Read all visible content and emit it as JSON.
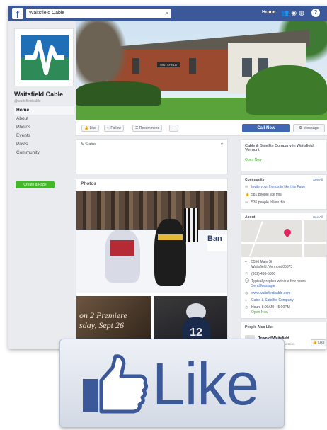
{
  "topbar": {
    "search_value": "Waitsfield Cable",
    "home_label": "Home"
  },
  "page": {
    "name": "Waitsfield Cable",
    "handle": "@waitsfieldcable"
  },
  "nav": {
    "items": [
      "Home",
      "About",
      "Photos",
      "Events",
      "Posts",
      "Community"
    ],
    "create_page": "Create a Page"
  },
  "cover": {
    "sign_text": "WAITSFIELD"
  },
  "actions": {
    "like": "Like",
    "follow": "Follow",
    "recommend": "Recommend",
    "more": "···",
    "call_now": "Call Now",
    "message": "Message"
  },
  "status": {
    "label": "Status"
  },
  "photos": {
    "title": "Photos",
    "board_text": "Ban",
    "movie_line1": "on 2 Premiere",
    "movie_line2": "sday, Sept 26",
    "jersey_number": "12"
  },
  "about_card": {
    "category": "Cable & Satellite Company in Waitsfield, Vermont",
    "status": "Open Now"
  },
  "community": {
    "title": "Community",
    "see_all": "See All",
    "invite": "Invite your friends to like this Page",
    "likes": "581 people like this",
    "follows": "535 people follow this"
  },
  "about": {
    "title": "About",
    "see_all": "See All",
    "address_line1": "5556 Main St",
    "address_line2": "Waitsfield, Vermont 05673",
    "phone": "(802) 496-5800",
    "response": "Typically replies within a few hours",
    "send_message": "Send Message",
    "website": "www.waitsfieldcable.com",
    "category": "Cable & Satellite Company",
    "hours": "Hours 8:00AM – 5:00PM",
    "open_now": "Open Now"
  },
  "also_like": {
    "title": "People Also Like",
    "page_name": "Town of Waitsfield",
    "page_sub": "Government Organization",
    "like_btn": "Like"
  },
  "overlay": {
    "like_text": "Like"
  },
  "colors": {
    "facebook_blue": "#3b5998",
    "button_blue": "#4267b2",
    "create_green": "#42b72a",
    "logo_green": "#2e8b57",
    "logo_blue": "#1e6fb8"
  }
}
